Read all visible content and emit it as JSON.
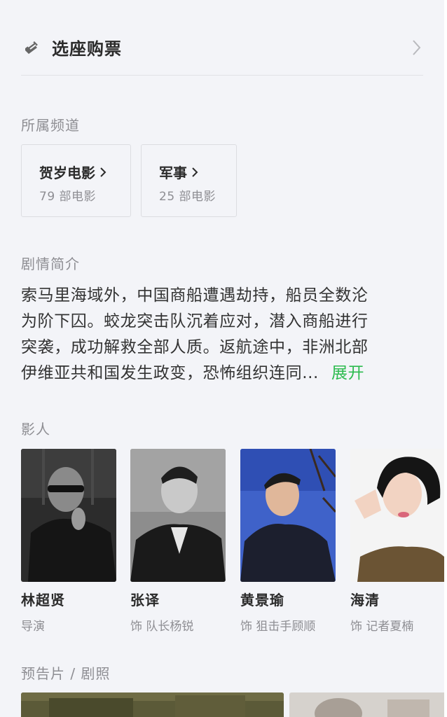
{
  "purchase": {
    "label": "选座购票",
    "icon": "ticket-icon",
    "chevron": "chevron-right-icon"
  },
  "channels": {
    "title": "所属频道",
    "items": [
      {
        "name": "贺岁电影",
        "count": "79 部电影"
      },
      {
        "name": "军事",
        "count": "25 部电影"
      }
    ]
  },
  "synopsis": {
    "title": "剧情简介",
    "lines": [
      "索马里海域外，中国商船遭遇劫持，船员全数沦",
      "为阶下囚。蛟龙突击队沉着应对，潜入商船进行",
      "突袭，成功解救全部人质。返航途中，非洲北部",
      "伊维亚共和国发生政变，恐怖组织连同..."
    ],
    "expand_label": "展开",
    "expand_color": "#2dbb4f"
  },
  "cast": {
    "title": "影人",
    "people": [
      {
        "name": "林超贤",
        "role": "导演"
      },
      {
        "name": "张译",
        "role": "饰 队长杨锐"
      },
      {
        "name": "黄景瑜",
        "role": "饰 狙击手顾顺"
      },
      {
        "name": "海清",
        "role": "饰 记者夏楠"
      }
    ]
  },
  "media": {
    "title": "预告片 / 剧照"
  }
}
